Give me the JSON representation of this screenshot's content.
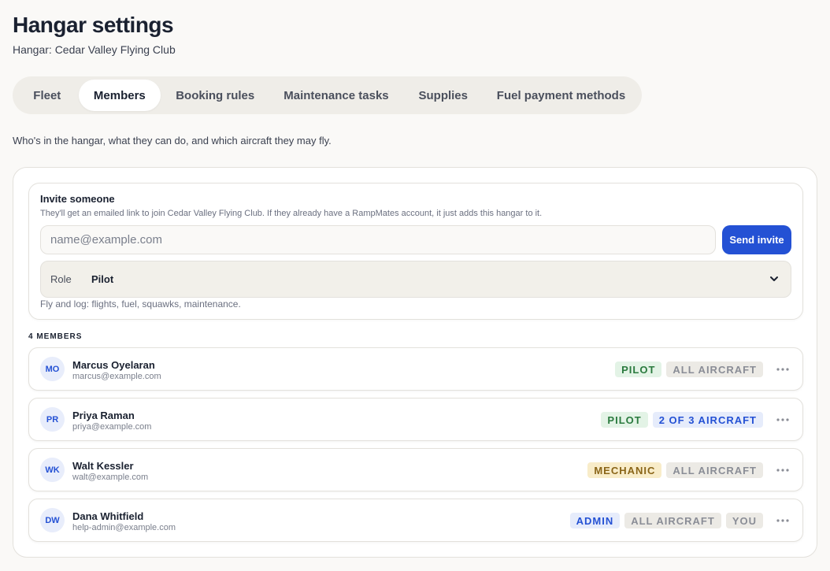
{
  "header": {
    "title": "Hangar settings",
    "subtitle": "Hangar: Cedar Valley Flying Club"
  },
  "tabs": [
    {
      "label": "Fleet",
      "active": false
    },
    {
      "label": "Members",
      "active": true
    },
    {
      "label": "Booking rules",
      "active": false
    },
    {
      "label": "Maintenance tasks",
      "active": false
    },
    {
      "label": "Supplies",
      "active": false
    },
    {
      "label": "Fuel payment methods",
      "active": false
    }
  ],
  "intro": "Who's in the hangar, what they can do, and which aircraft they may fly.",
  "invite": {
    "title": "Invite someone",
    "description": "They'll get an emailed link to join Cedar Valley Flying Club. If they already have a RampMates account, it just adds this hangar to it.",
    "email_placeholder": "name@example.com",
    "email_value": "",
    "send_label": "Send invite",
    "role_label": "Role",
    "role_value": "Pilot",
    "role_hint": "Fly and log: flights, fuel, squawks, maintenance."
  },
  "members": {
    "count_label": "4 MEMBERS",
    "rows": [
      {
        "initials": "MO",
        "name": "Marcus Oyelaran",
        "email": "marcus@example.com",
        "badges": [
          "PILOT",
          "ALL AIRCRAFT"
        ]
      },
      {
        "initials": "PR",
        "name": "Priya Raman",
        "email": "priya@example.com",
        "badges": [
          "PILOT",
          "2 OF 3 AIRCRAFT"
        ]
      },
      {
        "initials": "WK",
        "name": "Walt Kessler",
        "email": "walt@example.com",
        "badges": [
          "MECHANIC",
          "ALL AIRCRAFT"
        ]
      },
      {
        "initials": "DW",
        "name": "Dana Whitfield",
        "email": "help-admin@example.com",
        "badges": [
          "ADMIN",
          "ALL AIRCRAFT",
          "YOU"
        ]
      }
    ]
  },
  "colors": {
    "accent": "#2451d4",
    "pilot_badge": "#2a7a3e",
    "mechanic_badge": "#8a6518",
    "admin_badge": "#2451d4"
  },
  "icons": {
    "role_dropdown": "chevron-down-icon",
    "row_menu": "more-horizontal-icon"
  }
}
